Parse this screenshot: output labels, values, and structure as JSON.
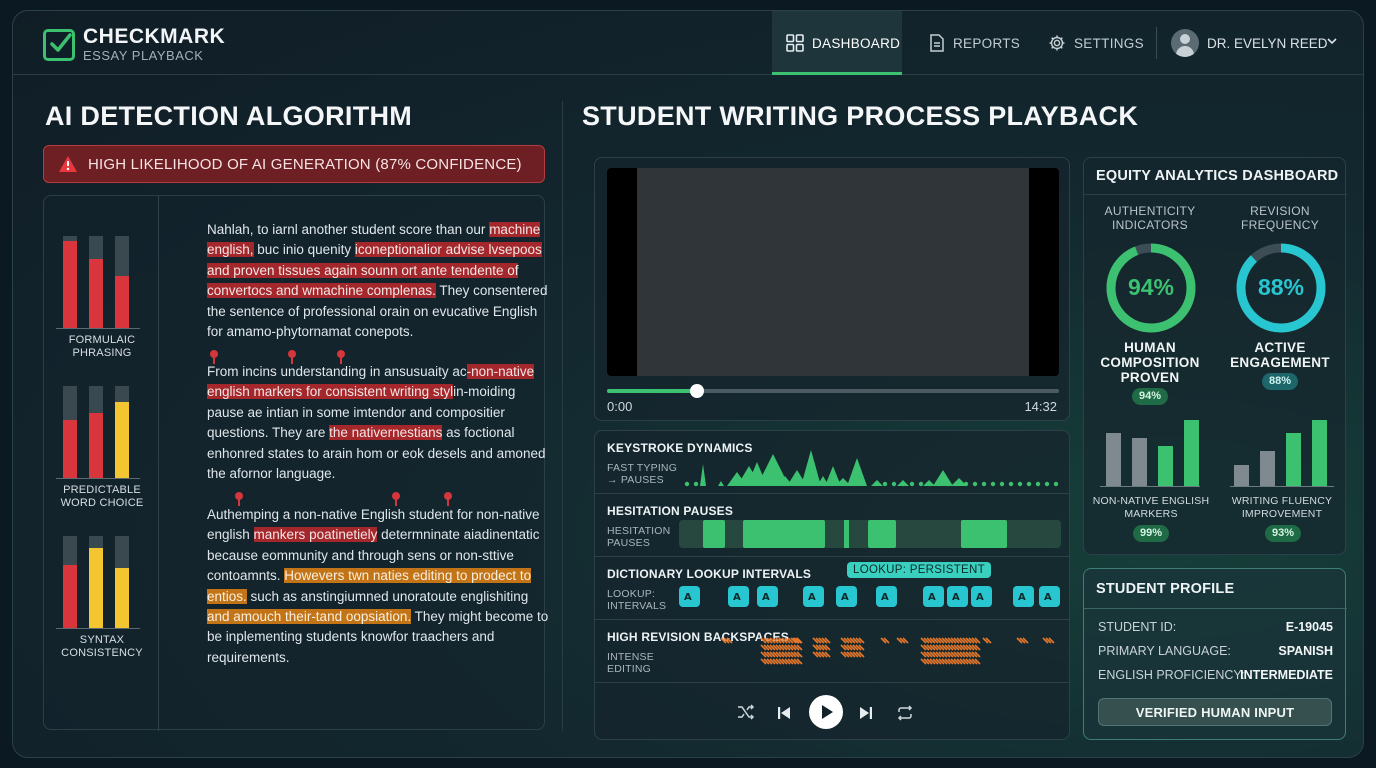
{
  "app": {
    "brand": "CHECKMARK",
    "brand_sub": "ESSAY PLAYBACK",
    "colors": {
      "accent": "#3bc16f",
      "teal": "#27c6d0",
      "alert": "#a4272b",
      "warning": "#c27416"
    }
  },
  "nav": {
    "dashboard": "DASHBOARD",
    "reports": "REPORTS",
    "settings": "SETTINGS",
    "user": "DR. EVELYN REED"
  },
  "ai_detection": {
    "title": "AI DETECTION ALGORITHM",
    "alert": "HIGH LIKELIHOOD OF AI GENERATION (87% CONFIDENCE)",
    "metrics": [
      {
        "label": "FORMULAIC PHRASING",
        "bars": [
          0.95,
          0.75,
          0.56
        ],
        "colors": [
          "#d8363c",
          "#d8363c",
          "#d8363c"
        ]
      },
      {
        "label": "PREDICTABLE WORD CHOICE",
        "bars": [
          0.63,
          0.71,
          0.83
        ],
        "colors": [
          "#d8363c",
          "#d8363c",
          "#f2c531"
        ]
      },
      {
        "label": "SYNTAX CONSISTENCY",
        "bars": [
          0.68,
          0.87,
          0.65
        ],
        "colors": [
          "#d8363c",
          "#f2c531",
          "#f2c531"
        ]
      }
    ],
    "essay": [
      [
        {
          "t": "Nahlah, to iarnl another student score than our "
        },
        {
          "t": "machine english,",
          "h": "red"
        },
        {
          "t": " buc inio quenity "
        },
        {
          "t": "iconeptionalior advise lvsepoos and proven tissues again sounn ort ante tendente of convertocs and wmachine complenas.",
          "h": "red"
        },
        {
          "t": " They consentered the sentence of professional orain on evucative English for amamo-phytornamat conepots."
        }
      ],
      [
        {
          "t": "From incins understanding in ansusuaity ac"
        },
        {
          "t": "-non-native english markers for consistent writing styl",
          "h": "red"
        },
        {
          "t": "in-moiding pause ae intian in some imtendor and compositier questions. They are "
        },
        {
          "t": "the nativernestians",
          "h": "red"
        },
        {
          "t": " as foctional enhonred states to arain hom or eok desels and amoned the afornor language."
        }
      ],
      [
        {
          "t": "Authemping a non-native English student for non-native english "
        },
        {
          "t": "mankers poatinetiely",
          "h": "red"
        },
        {
          "t": " determninate aiadinentatic because eommunity and through sens or non-sttive contoamnts. "
        },
        {
          "t": "Howevers twn naties editing to prodect to entios.",
          "h": "orange"
        },
        {
          "t": " such as anstingiumned unoratoute englishiting "
        },
        {
          "t": "and amouch their-tand oopsiation.",
          "h": "orange"
        },
        {
          "t": " They might become to be inplementing students knowfor traachers and requirements."
        }
      ]
    ]
  },
  "playback": {
    "title": "STUDENT WRITING PROCESS PLAYBACK",
    "time_start": "0:00",
    "time_end": "14:32",
    "progress": 0.2,
    "tracks": [
      {
        "title": "KEYSTROKE DYNAMICS",
        "sub": "FAST TYPING\n→ PAUSES"
      },
      {
        "title": "HESITATION PAUSES",
        "sub": "HESITATION\nPAUSES"
      },
      {
        "title": "DICTIONARY LOOKUP INTERVALS",
        "sub": "LOOKUP:\nINTERVALS",
        "badge": "LOOKUP: PERSISTENT"
      },
      {
        "title": "HIGH REVISION BACKSPACES",
        "sub": "INTENSE\nEDITING"
      }
    ]
  },
  "equity": {
    "title": "EQUITY ANALYTICS DASHBOARD",
    "authenticity": {
      "label": "AUTHENTICITY INDICATORS",
      "value": "94%",
      "fraction": 0.94,
      "caption": "HUMAN COMPOSITION PROVEN",
      "badge": "94%"
    },
    "revision": {
      "label": "REVISION FREQUENCY",
      "value": "88%",
      "fraction": 0.88,
      "caption": "ACTIVE ENGAGEMENT",
      "badge": "88%"
    },
    "non_native": {
      "label": "NON-NATIVE ENGLISH MARKERS",
      "badge": "99%",
      "bars": [
        0.8,
        0.72,
        0.6,
        1.0
      ]
    },
    "fluency": {
      "label": "WRITING FLUENCY IMPROVEMENT",
      "badge": "93%",
      "bars": [
        0.32,
        0.53,
        0.81,
        1.0
      ]
    }
  },
  "profile": {
    "title": "STUDENT PROFILE",
    "rows": [
      {
        "k": "STUDENT ID:",
        "v": "E-19045"
      },
      {
        "k": "PRIMARY LANGUAGE:",
        "v": "SPANISH"
      },
      {
        "k": "ENGLISH PROFICIENCY:",
        "v": "INTERMEDIATE"
      }
    ],
    "verify": "VERIFIED HUMAN INPUT"
  }
}
